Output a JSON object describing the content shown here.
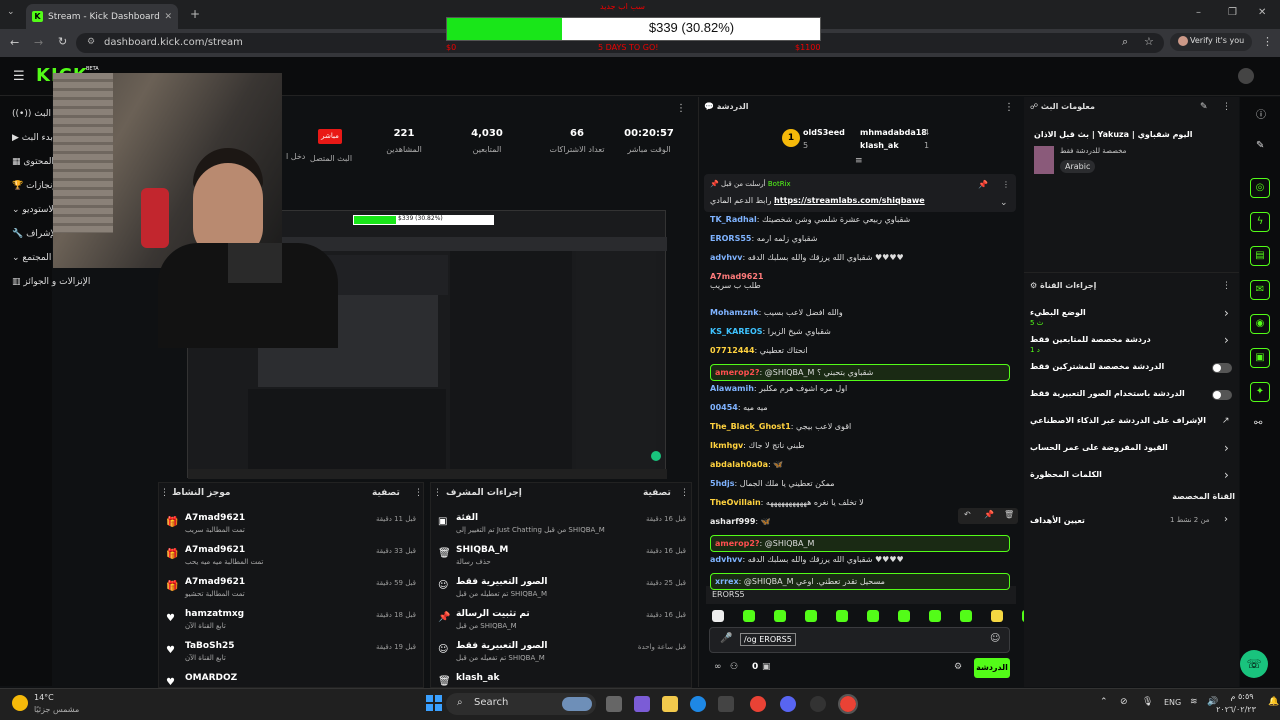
{
  "browser": {
    "tab_title": "Stream - Kick Dashboard",
    "url": "dashboard.kick.com/stream",
    "profile": "Verify it's you"
  },
  "goal": {
    "title": "سب اب جديد",
    "amount": "$339 (30.82%)",
    "left": "$0",
    "middle": "5 DAYS TO GO!",
    "right": "$1100",
    "progress": 0.3082,
    "mini_amount": "$339 (30.82%)"
  },
  "brand": {
    "logo": "KICK",
    "beta": "BETA"
  },
  "sidebar": {
    "items": [
      "البث",
      "بدء البث",
      "المحتوى",
      "الإنجازات",
      "الاستوديو",
      "الإشراف",
      "المجتمع",
      "الإنزالات و الجوائز"
    ]
  },
  "stats": {
    "live_badge": "مباشر",
    "stream_label": "البث المتصل",
    "items": [
      {
        "value": "00:20:57",
        "label": "الوقت مباشر"
      },
      {
        "value": "66",
        "label": "تعداد الاشتراكات"
      },
      {
        "value": "4,030",
        "label": "المتابعين"
      },
      {
        "value": "221",
        "label": "المشاهدين"
      }
    ],
    "partial_label": "دخل ا"
  },
  "activity_feed": {
    "title": "موجز النشاط",
    "filter": "تصفية",
    "items": [
      {
        "name": "A7mad9621",
        "sub": "تمت المطالبة سريب",
        "time": "قبل 11 دقيقة",
        "icon": "gift"
      },
      {
        "name": "A7mad9621",
        "sub": "تمت المطالبة ميه ميه يحب",
        "time": "قبل 33 دقيقة",
        "icon": "gift"
      },
      {
        "name": "A7mad9621",
        "sub": "تمت المطالبة تحشيو",
        "time": "قبل 59 دقيقة",
        "icon": "gift"
      },
      {
        "name": "hamzatmxg",
        "sub": "تابع القناة الآن",
        "time": "قبل 18 دقيقة",
        "icon": "heart"
      },
      {
        "name": "TaBoSh25",
        "sub": "تابع القناة الآن",
        "time": "قبل 19 دقيقة",
        "icon": "heart"
      },
      {
        "name": "OMARDOZ",
        "sub": "",
        "time": "",
        "icon": "heart"
      }
    ]
  },
  "mod_actions": {
    "title": "إجراءات المشرف",
    "filter": "تصفية",
    "items": [
      {
        "name": "الفئة",
        "sub": "تم التغيير إلى Just Chatting من قبل SHIQBA_M",
        "time": "قبل 16 دقيقة",
        "icon": "category"
      },
      {
        "name": "SHIQBA_M",
        "sub": "حذف رسالة",
        "time": "قبل 16 دقيقة",
        "icon": "trash"
      },
      {
        "name": "الصور التعبيرية فقط",
        "sub": "تم تعطيله من قبل SHIQBA_M",
        "time": "قبل 25 دقيقة",
        "icon": "emoji"
      },
      {
        "name": "تم تثبيت الرسالة",
        "sub": "من قبل SHIQBA_M",
        "time": "قبل 16 دقيقة",
        "icon": "pin"
      },
      {
        "name": "الصور التعبيرية فقط",
        "sub": "تم تفعيله من قبل SHIQBA_M",
        "time": "قبل ساعة واحدة",
        "icon": "emoji"
      },
      {
        "name": "klash_ak",
        "sub": "",
        "time": "",
        "icon": "trash"
      }
    ]
  },
  "chat": {
    "title": "الدردشة",
    "top": [
      {
        "name": "oldS3eed",
        "count": "5"
      },
      {
        "name": "mhmadabda18",
        "count": "4"
      },
      {
        "name": "klash_ak",
        "count": "1"
      }
    ],
    "pinned": {
      "by": "أرسلت من قبل",
      "user": "BotRix",
      "text": "رابط الدعم المادي",
      "link": "https://streamlabs.com/shiqbawe"
    },
    "messages": [
      {
        "user": "TK_Radhal",
        "text": "شقباوي ربيعي عشرة شلسي وشن شخصيتك",
        "color": "#7fb3ff",
        "hl": false
      },
      {
        "user": "ERORS55",
        "text": "شقباوي زلمه ارمه",
        "color": "#7fb3ff",
        "hl": false
      },
      {
        "user": "advhvv",
        "text": "شقباوي الله يرزقك والله بسلبك الدقه ♥♥♥♥",
        "color": "#7fb3ff",
        "hl": false
      },
      {
        "user": "A7mad9621",
        "text": "طلب ب سريب",
        "color": "#ff7b7b",
        "hl": false
      },
      {
        "user": "Mohamznk",
        "text": "والله افضل لاعب بسيب",
        "color": "#7fb3ff",
        "hl": false
      },
      {
        "user": "KS_KAREOS",
        "text": "شقباوي شيخ الزيرا",
        "color": "#3ec3ff",
        "hl": false
      },
      {
        "user": "07712444",
        "text": "انحتاك تعطيني",
        "color": "#ffd23f",
        "hl": false
      },
      {
        "user": "amerop2?",
        "text": "@SHIQBA_M شقباوي بتحبني ؟",
        "color": "#ff4f4f",
        "hl": true
      },
      {
        "user": "Alawamih",
        "text": "اول مره اشوف هرم مكلبر",
        "color": "#7fb3ff",
        "hl": false
      },
      {
        "user": "00454",
        "text": "ميه ميه",
        "color": "#7fb3ff",
        "hl": false
      },
      {
        "user": "The_Black_Ghost1",
        "text": "اقوى لاعب بيجي",
        "color": "#ffd23f",
        "hl": false
      },
      {
        "user": "Ikmhgv",
        "text": "طبني ناتج لا جاك",
        "color": "#ffd23f",
        "hl": false
      },
      {
        "user": "abdalah0a0a",
        "text": "🦋",
        "color": "#ffd23f",
        "hl": false
      },
      {
        "user": "5hdjs",
        "text": "ممكن تعطيني يا ملك الجمال",
        "color": "#7fb3ff",
        "hl": false
      },
      {
        "user": "TheOvillain",
        "text": "لا تخلف يا نغره هههههههههههه",
        "color": "#ffd23f",
        "hl": false
      },
      {
        "user": "asharf999",
        "text": "🦋",
        "color": "#eee",
        "hl": false
      },
      {
        "user": "amerop2?",
        "text": "@SHIQBA_M",
        "color": "#ff4f4f",
        "hl": true
      },
      {
        "user": "advhvv",
        "text": "شقباوي الله يرزقك والله بسلبك الدقه ♥♥♥♥",
        "color": "#7fb3ff",
        "hl": false
      },
      {
        "user": "xrrex",
        "text": "@SHIQBA_M مسحيل تقدر تعطني. اوعي",
        "color": "#7fb3ff",
        "hl": true
      }
    ],
    "suggestion": "ERORS5",
    "input_value": "/og ERORS5",
    "points": "0",
    "send_label": "الدردشة"
  },
  "stream_info": {
    "title": "معلومات البث",
    "stream_title": "بث قبل الاذان | Yakuza | اليوم شقباوي",
    "desc": "مخصصة للدردشة فقط",
    "language": "Arabic"
  },
  "channel_actions": {
    "title": "إجراءات القناة",
    "items": [
      {
        "label": "الوضع البطيء",
        "sub": "5 ث",
        "type": "arrow"
      },
      {
        "label": "دردشة مخصصة للمتابعين فقط",
        "sub": "1 د",
        "type": "arrow"
      },
      {
        "label": "الدردشة مخصصة للمشتركين فقط",
        "sub": "",
        "type": "toggle"
      },
      {
        "label": "الدردشة باستخدام الصور التعبيرية فقط",
        "sub": "",
        "type": "toggle"
      },
      {
        "label": "الإشراف على الدردشة عبر الذكاء الاصطناعي",
        "sub": "",
        "type": "ext"
      },
      {
        "label": "القيود المفروضة على عمر الحساب",
        "sub": "",
        "type": "arrow"
      },
      {
        "label": "الكلمات المحظورة",
        "sub": "",
        "type": "arrow"
      }
    ],
    "shortcuts_title": "القناة المخصصة",
    "goals": {
      "label": "تعيين الأهداف",
      "sub": "1 من 2 نشط"
    }
  },
  "taskbar": {
    "weather_temp": "14°C",
    "weather_desc": "مشمس جزئيًا",
    "search": "Search",
    "lang": "ENG",
    "time": "٥:٥٩ م",
    "date": "٢٠٢٦/٠٢/٢٣"
  }
}
